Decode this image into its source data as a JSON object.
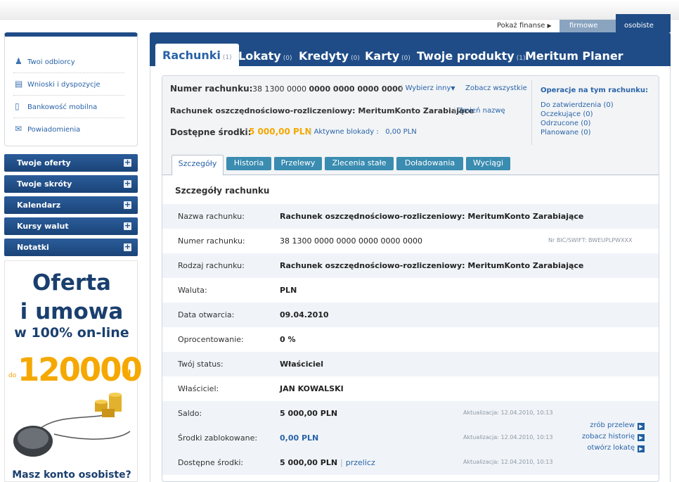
{
  "header": {
    "show_finances": "Pokaż finanse",
    "tab_business": "firmowe",
    "tab_personal": "osobiste"
  },
  "sidebar": {
    "links": [
      {
        "label": "Twoi odbiorcy",
        "icon": "person-icon"
      },
      {
        "label": "Wnioski i dyspozycje",
        "icon": "document-icon"
      },
      {
        "label": "Bankowość mobilna",
        "icon": "phone-icon"
      },
      {
        "label": "Powiadomienia",
        "icon": "notification-icon"
      }
    ],
    "panels": [
      "Twoje oferty",
      "Twoje skróty",
      "Kalendarz",
      "Kursy walut",
      "Notatki"
    ],
    "promo": {
      "line1": "Oferta",
      "line2": "i umowa",
      "line3": "w 100% on-line",
      "prefix": "do",
      "amount": "120000",
      "currency": "zł",
      "question": "Masz konto osobiste?"
    }
  },
  "product_tabs": [
    {
      "label": "Rachunki",
      "count": "(1)"
    },
    {
      "label": "Lokaty",
      "count": "(0)"
    },
    {
      "label": "Kredyty",
      "count": "(0)"
    },
    {
      "label": "Karty",
      "count": "(0)"
    },
    {
      "label": "Twoje produkty",
      "count": "(1)"
    },
    {
      "label": "Meritum Planer",
      "count": ""
    }
  ],
  "account": {
    "number_label": "Numer rachunku:",
    "number_prefix": "38 1300 0000",
    "number_rest": "0000 0000 0000 0000",
    "choose_other": "Wybierz inny",
    "see_all": "Zobacz wszystkie",
    "name": "Rachunek oszczędnościowo-rozliczeniowy: MeritumKonto Zarabiające",
    "rename": "Zmień nazwę",
    "available_label": "Dostępne środki:",
    "available_value": "5 000,00 PLN",
    "blocks_label": "Aktywne blokady :",
    "blocks_value": "0,00 PLN"
  },
  "operations": {
    "title": "Operacje na tym rachunku:",
    "items": [
      "Do zatwierdzenia (0)",
      "Oczekujące (0)",
      "Odrzucone (0)",
      "Planowane (0)"
    ]
  },
  "sub_tabs": [
    "Szczegóły",
    "Historia",
    "Przelewy",
    "Zlecenia stałe",
    "Doładowania",
    "Wyciągi"
  ],
  "details": {
    "title": "Szczegóły rachunku",
    "rows": [
      {
        "label": "Nazwa rachunku:",
        "value": "Rachunek oszczędnościowo-rozliczeniowy: MeritumKonto Zarabiające"
      },
      {
        "label": "Numer rachunku:",
        "value": "38 1300 0000 0000 0000 0000 0000",
        "note": "Nr BIC/SWIFT: BWEUPLPWXXX"
      },
      {
        "label": "Rodzaj rachunku:",
        "value": "Rachunek oszczędnościowo-rozliczeniowy: MeritumKonto Zarabiające"
      },
      {
        "label": "Waluta:",
        "value": "PLN"
      },
      {
        "label": "Data otwarcia:",
        "value": "09.04.2010"
      },
      {
        "label": "Oprocentowanie:",
        "value": "0 %"
      },
      {
        "label": "Twój status:",
        "value": "Właściciel"
      },
      {
        "label": "Właściciel:",
        "value": "JAN KOWALSKI"
      },
      {
        "label": "Saldo:",
        "value": "5 000,00 PLN",
        "note": "Aktualizacja: 12.04.2010, 10:13"
      },
      {
        "label": "Środki zablokowane:",
        "value": "0,00 PLN",
        "note": "Aktualizacja: 12.04.2010, 10:13"
      },
      {
        "label": "Dostępne środki:",
        "value": "5 000,00 PLN",
        "link": "przelicz",
        "note": "Aktualizacja: 12.04.2010, 10:13"
      }
    ]
  },
  "quick_actions": [
    "zrób przelew",
    "zobacz historię",
    "otwórz lokatę"
  ],
  "colors": {
    "primary": "#1f4c87",
    "accent": "#f5a800",
    "link": "#2a63a8",
    "tab": "#3a8cb0"
  }
}
